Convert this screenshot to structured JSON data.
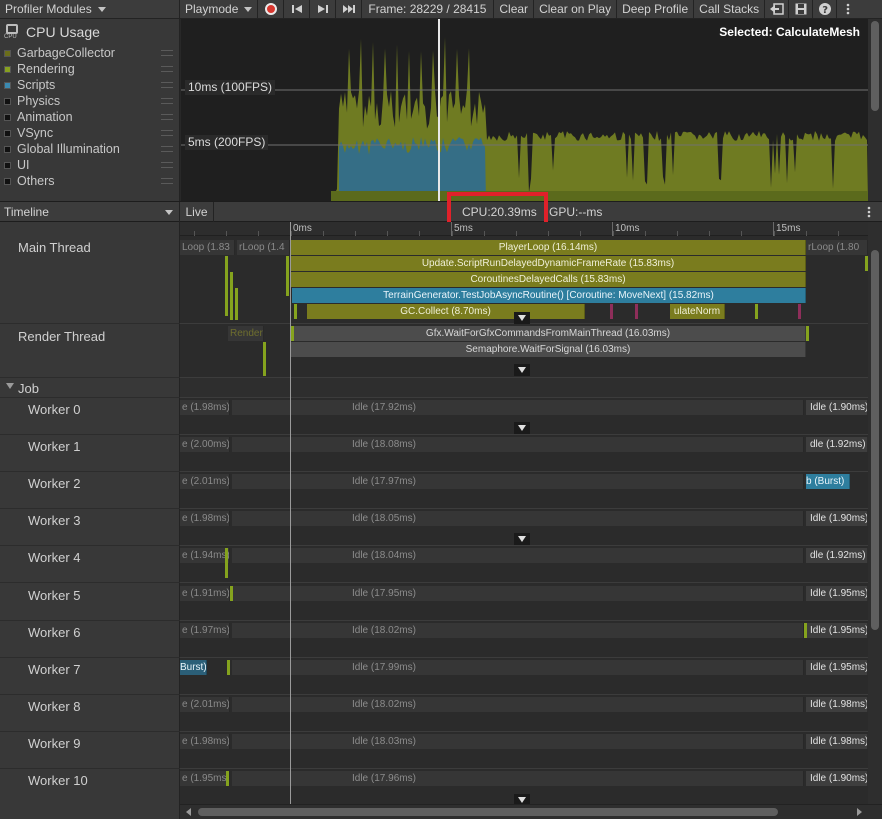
{
  "toolbar": {
    "modules_label": "Profiler Modules",
    "playmode_label": "Playmode",
    "frame_label": "Frame: 28229 / 28415",
    "clear_label": "Clear",
    "clear_on_play_label": "Clear on Play",
    "deep_profile_label": "Deep Profile",
    "call_stacks_label": "Call Stacks",
    "icons": [
      "record-icon",
      "first-frame-icon",
      "prev-frame-icon",
      "next-frame-icon",
      "last-frame-icon",
      "load-icon",
      "save-icon",
      "help-icon",
      "more-icon"
    ]
  },
  "module": {
    "title": "CPU Usage",
    "icon": "cpu-icon",
    "legend": [
      {
        "label": "GarbageCollector",
        "color": "#6b6e1a"
      },
      {
        "label": "Rendering",
        "color": "#87a020"
      },
      {
        "label": "Scripts",
        "color": "#3b8ab0"
      },
      {
        "label": "Physics",
        "color": "#111111"
      },
      {
        "label": "Animation",
        "color": "#111111"
      },
      {
        "label": "VSync",
        "color": "#111111"
      },
      {
        "label": "Global Illumination",
        "color": "#111111"
      },
      {
        "label": "UI",
        "color": "#111111"
      },
      {
        "label": "Others",
        "color": "#111111"
      }
    ]
  },
  "chart": {
    "label_10ms": "10ms (100FPS)",
    "label_5ms": "5ms (200FPS)",
    "selected": "Selected: CalculateMesh"
  },
  "timeline_header": {
    "view_label": "Timeline",
    "live_label": "Live",
    "cpu_label": "CPU:20.39ms",
    "gpu_label": "GPU:--ms"
  },
  "ruler": {
    "ticks": [
      "0ms",
      "5ms",
      "10ms",
      "15ms"
    ]
  },
  "threads": {
    "main": "Main Thread",
    "render": "Render Thread",
    "job_group": "Job",
    "workers": [
      "Worker 0",
      "Worker 1",
      "Worker 2",
      "Worker 3",
      "Worker 4",
      "Worker 5",
      "Worker 6",
      "Worker 7",
      "Worker 8",
      "Worker 9",
      "Worker 10"
    ]
  },
  "main_thread": {
    "prev_playerloop": "Loop (1.83",
    "prev_playerloop2": "rLoop (1.4",
    "next_playerloop": "rLoop (1.80",
    "bars": {
      "player_loop": "PlayerLoop (16.14ms)",
      "update": "Update.ScriptRunDelayedDynamicFrameRate (15.83ms)",
      "coroutines": "CoroutinesDelayedCalls (15.83ms)",
      "terrain": "TerrainGenerator.TestJobAsyncRoutine() [Coroutine: MoveNext] (15.82ms)",
      "gc": "GC.Collect (8.70ms)",
      "calc": "ulateNorm"
    }
  },
  "render_thread": {
    "prev": "Render",
    "wait_gfx": "Gfx.WaitForGfxCommandsFromMainThread (16.03ms)",
    "semaphore": "Semaphore.WaitForSignal (16.03ms)"
  },
  "workers": [
    {
      "prev": "e (1.98ms)",
      "idle": "Idle (17.92ms)",
      "next": "Idle (1.90ms)"
    },
    {
      "prev": "e (2.00ms)",
      "idle": "Idle (18.08ms)",
      "next": "dle (1.92ms)"
    },
    {
      "prev": "e (2.01ms)",
      "idle": "Idle (17.97ms)",
      "next": "b (Burst)"
    },
    {
      "prev": "e (1.98ms)",
      "idle": "Idle (18.05ms)",
      "next": "Idle (1.90ms)"
    },
    {
      "prev": "e (1.94ms)",
      "idle": "Idle (18.04ms)",
      "next": "dle (1.92ms)"
    },
    {
      "prev": "e (1.91ms)",
      "idle": "Idle (17.95ms)",
      "next": "Idle (1.95ms)"
    },
    {
      "prev": "e (1.97ms)",
      "idle": "Idle (18.02ms)",
      "next": "Idle (1.95ms)"
    },
    {
      "prev": "Burst)",
      "idle": "Idle (17.99ms)",
      "next": "Idle (1.95ms)"
    },
    {
      "prev": "e (2.01ms)",
      "idle": "Idle (18.02ms)",
      "next": "Idle (1.98ms)"
    },
    {
      "prev": "e (1.98ms)",
      "idle": "Idle (18.03ms)",
      "next": "Idle (1.98ms)"
    },
    {
      "prev": "e (1.95ms)",
      "idle": "Idle (17.96ms)",
      "next": "Idle (1.90ms)"
    }
  ]
}
